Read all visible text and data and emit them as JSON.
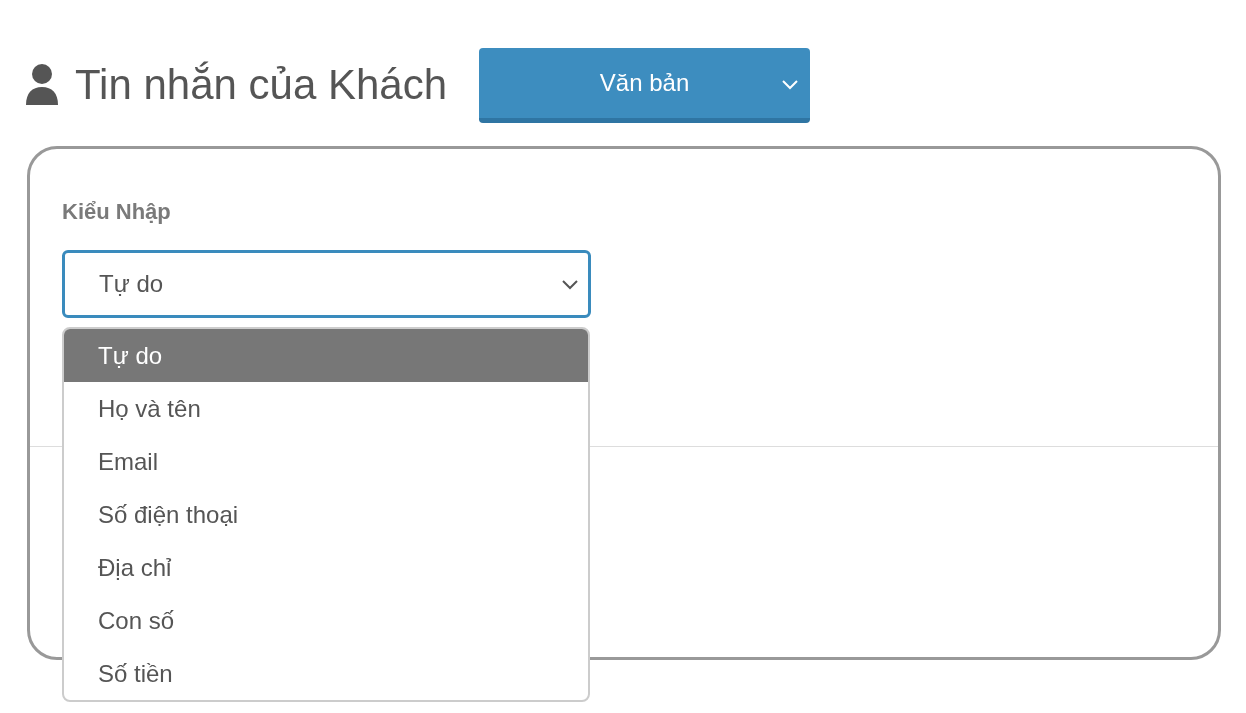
{
  "header": {
    "title": "Tin nhắn của Khách",
    "type_select": {
      "value": "Văn bản"
    }
  },
  "form": {
    "label": "Kiểu Nhập",
    "select": {
      "value": "Tự do",
      "expanded": true
    },
    "options": [
      {
        "label": "Tự do",
        "selected": true
      },
      {
        "label": "Họ và tên",
        "selected": false
      },
      {
        "label": "Email",
        "selected": false
      },
      {
        "label": "Số điện thoại",
        "selected": false
      },
      {
        "label": "Địa chỉ",
        "selected": false
      },
      {
        "label": "Con số",
        "selected": false
      },
      {
        "label": "Số tiền",
        "selected": false
      }
    ]
  }
}
